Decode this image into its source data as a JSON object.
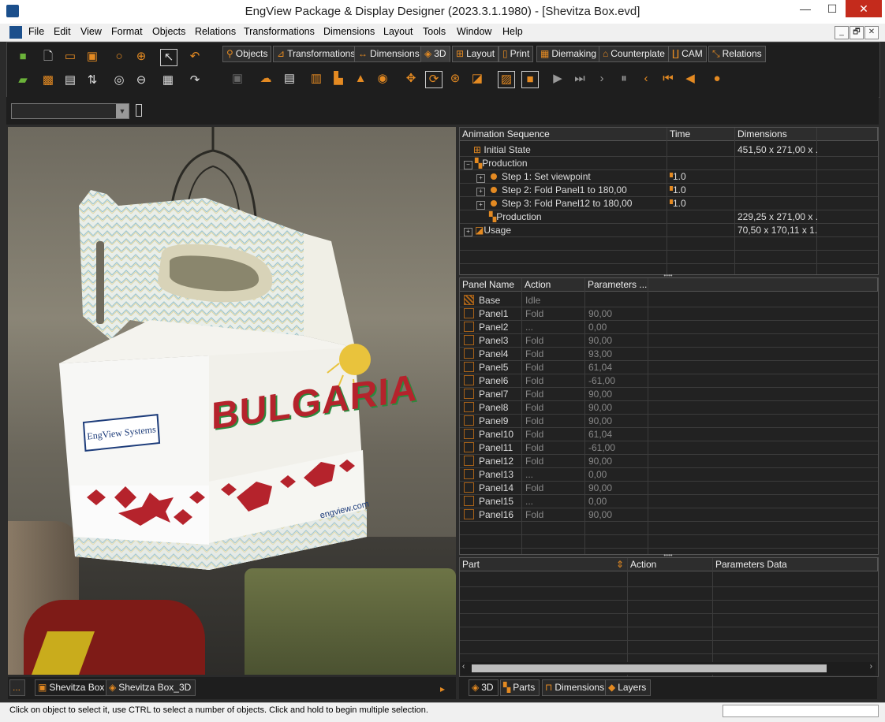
{
  "window": {
    "title": "EngView Package & Display Designer (2023.3.1.1980) - [Shevitza Box.evd]",
    "minimize": "—",
    "maximize": "☐",
    "close": "✕"
  },
  "menu": [
    "File",
    "Edit",
    "View",
    "Format",
    "Objects",
    "Relations",
    "Transformations",
    "Dimensions",
    "Layout",
    "Tools",
    "Window",
    "Help"
  ],
  "mdi_buttons": [
    "_",
    "🗗",
    "✕"
  ],
  "toolbar_tabs": [
    {
      "label": "Objects",
      "icon": "objects-icon"
    },
    {
      "label": "Transformations",
      "icon": "transformations-icon"
    },
    {
      "label": "Dimensions",
      "icon": "dimensions-icon"
    },
    {
      "label": "3D",
      "icon": "3d-icon"
    },
    {
      "label": "Layout",
      "icon": "layout-icon"
    },
    {
      "label": "Print",
      "icon": "print-icon"
    },
    {
      "label": "Diemaking",
      "icon": "diemaking-icon"
    },
    {
      "label": "Counterplate",
      "icon": "counterplate-icon"
    },
    {
      "label": "CAM",
      "icon": "cam-icon"
    },
    {
      "label": "Relations",
      "icon": "relations-icon"
    }
  ],
  "active_tab": "3D",
  "viewport": {
    "brand_panel": "EngView Systems",
    "headline": "BULGARIA",
    "url": "engview.com"
  },
  "animation": {
    "headers": [
      "Animation Sequence",
      "Time",
      "Dimensions"
    ],
    "rows": [
      {
        "name": "Initial State",
        "time": "",
        "dim": "451,50 x 271,00 x ..."
      },
      {
        "name": "Production",
        "time": "",
        "dim": ""
      },
      {
        "name": "Step 1: Set viewpoint",
        "time": "1.0",
        "dim": ""
      },
      {
        "name": "Step 2: Fold Panel1 to 180,00",
        "time": "1.0",
        "dim": ""
      },
      {
        "name": "Step 3: Fold Panel12 to 180,00",
        "time": "1.0",
        "dim": ""
      },
      {
        "name": "Production",
        "time": "",
        "dim": "229,25 x 271,00 x ..."
      },
      {
        "name": "Usage",
        "time": "",
        "dim": "70,50 x 170,11 x 1..."
      }
    ]
  },
  "panels": {
    "headers": [
      "Panel Name",
      "Action",
      "Parameters ..."
    ],
    "rows": [
      {
        "name": "Base",
        "action": "Idle",
        "param": ""
      },
      {
        "name": "Panel1",
        "action": "Fold",
        "param": "90,00"
      },
      {
        "name": "Panel2",
        "action": "...",
        "param": "0,00"
      },
      {
        "name": "Panel3",
        "action": "Fold",
        "param": "90,00"
      },
      {
        "name": "Panel4",
        "action": "Fold",
        "param": "93,00"
      },
      {
        "name": "Panel5",
        "action": "Fold",
        "param": "61,04"
      },
      {
        "name": "Panel6",
        "action": "Fold",
        "param": "-61,00"
      },
      {
        "name": "Panel7",
        "action": "Fold",
        "param": "90,00"
      },
      {
        "name": "Panel8",
        "action": "Fold",
        "param": "90,00"
      },
      {
        "name": "Panel9",
        "action": "Fold",
        "param": "90,00"
      },
      {
        "name": "Panel10",
        "action": "Fold",
        "param": "61,04"
      },
      {
        "name": "Panel11",
        "action": "Fold",
        "param": "-61,00"
      },
      {
        "name": "Panel12",
        "action": "Fold",
        "param": "90,00"
      },
      {
        "name": "Panel13",
        "action": "...",
        "param": "0,00"
      },
      {
        "name": "Panel14",
        "action": "Fold",
        "param": "90,00"
      },
      {
        "name": "Panel15",
        "action": "...",
        "param": "0,00"
      },
      {
        "name": "Panel16",
        "action": "Fold",
        "param": "90,00"
      }
    ]
  },
  "parts": {
    "headers": [
      "Part",
      "Action",
      "Parameters Data"
    ]
  },
  "doc_tabs": {
    "more": "...",
    "tabs": [
      "Shevitza Box",
      "Shevitza Box_3D"
    ]
  },
  "right_tabs": [
    "3D",
    "Parts",
    "Dimensions",
    "Layers"
  ],
  "status": "Click on object to select it, use CTRL to select a number of objects. Click and hold to begin multiple selection.",
  "colors": {
    "accent": "#e48a22",
    "close": "#c42b1c",
    "panel_bg": "#222222"
  }
}
